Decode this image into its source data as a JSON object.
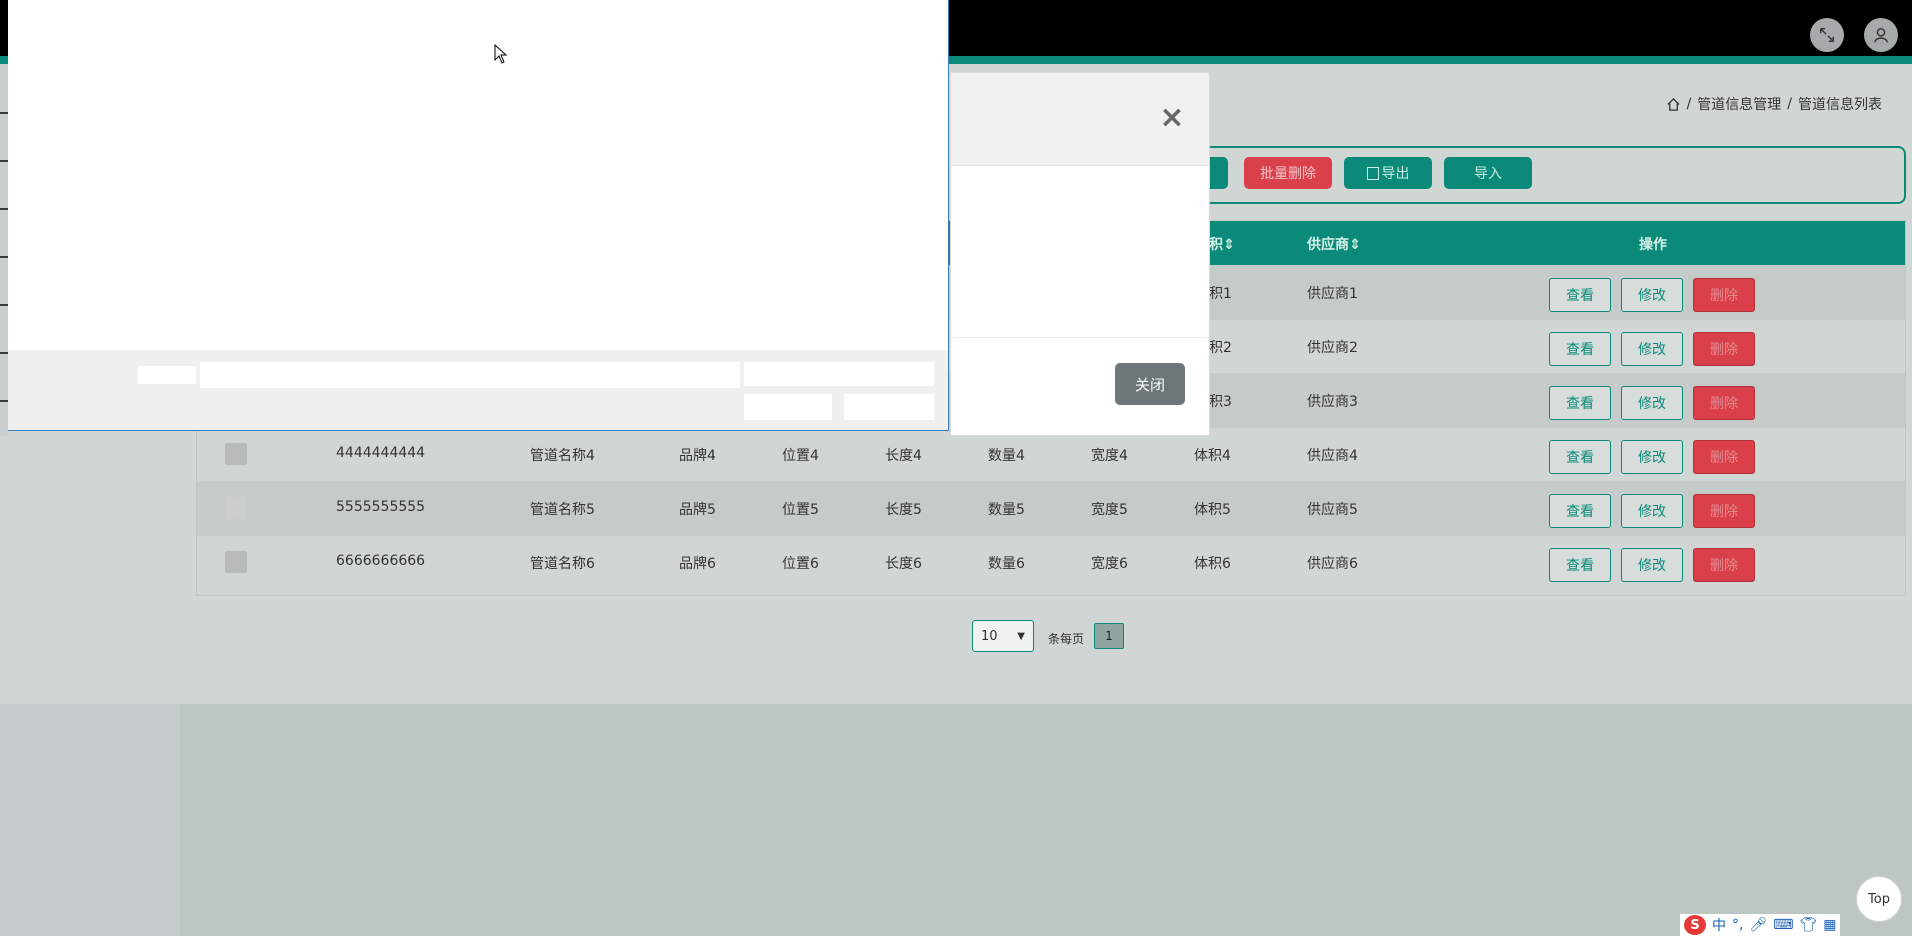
{
  "breadcrumb": {
    "level1": "管道信息管理",
    "level2": "管道信息列表",
    "sep": "/"
  },
  "toolbar": {
    "batch_delete": "批量删除",
    "export": "导出",
    "import": "导入"
  },
  "table": {
    "headers": {
      "volume": "积",
      "supplier": "供应商",
      "actions": "操作"
    },
    "rows": [
      {
        "volume": "积1",
        "supplier": "供应商1"
      },
      {
        "volume": "积2",
        "supplier": "供应商2"
      },
      {
        "volume": "积3",
        "supplier": "供应商3"
      },
      {
        "code": "4444444444",
        "name": "管道名称4",
        "brand": "品牌4",
        "location": "位置4",
        "length": "长度4",
        "quantity": "数量4",
        "width": "宽度4",
        "volume": "体积4",
        "supplier": "供应商4"
      },
      {
        "code": "5555555555",
        "name": "管道名称5",
        "brand": "品牌5",
        "location": "位置5",
        "length": "长度5",
        "quantity": "数量5",
        "width": "宽度5",
        "volume": "体积5",
        "supplier": "供应商5"
      },
      {
        "code": "6666666666",
        "name": "管道名称6",
        "brand": "品牌6",
        "location": "位置6",
        "length": "长度6",
        "quantity": "数量6",
        "width": "宽度6",
        "volume": "体积6",
        "supplier": "供应商6"
      }
    ],
    "action_view": "查看",
    "action_edit": "修改",
    "action_delete": "删除"
  },
  "pager": {
    "page_size": "10",
    "per_page_label": "条每页",
    "current_page": "1"
  },
  "dialog": {
    "close_label": "关闭",
    "close_x": "×"
  },
  "top_button": "Top",
  "ime": {
    "logo": "S",
    "lang": "中"
  },
  "colors": {
    "accent": "#0b8a7a",
    "danger": "#d9404a",
    "topbar": "#000000"
  }
}
